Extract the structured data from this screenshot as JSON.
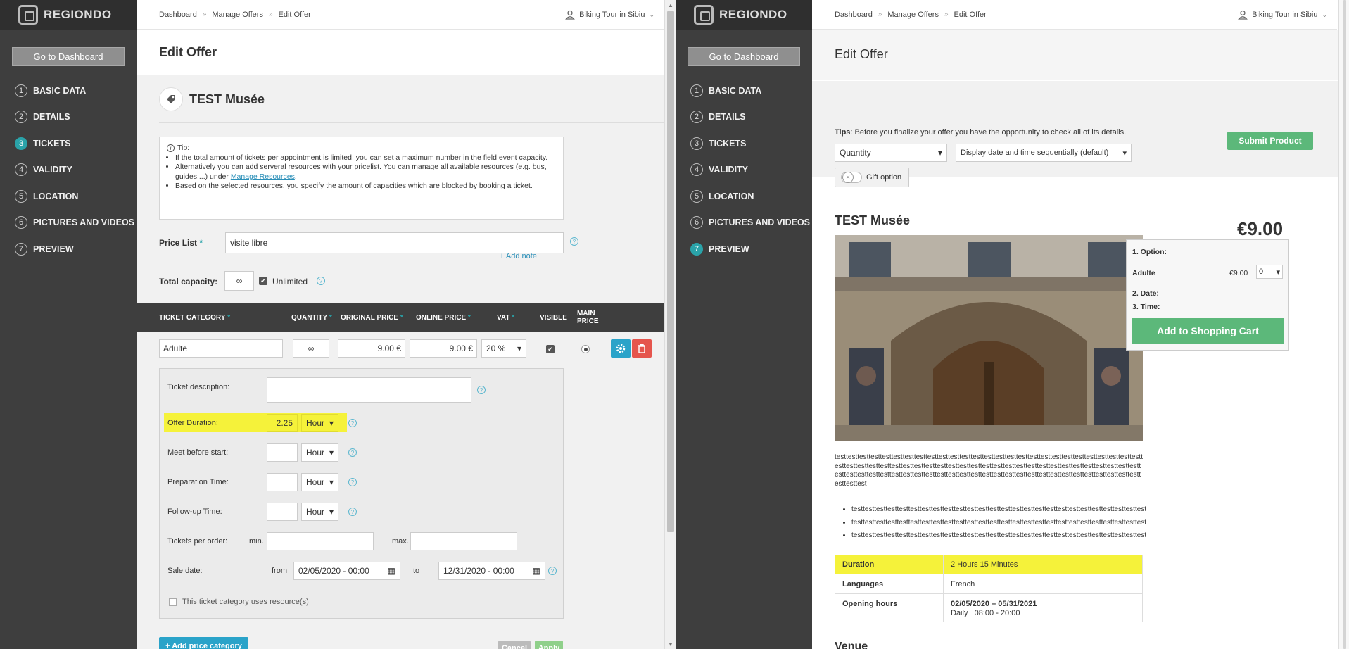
{
  "brand": "REGIONDO",
  "sidebar": {
    "dashboard_button": "Go to Dashboard",
    "items": [
      {
        "num": "1",
        "label": "BASIC DATA"
      },
      {
        "num": "2",
        "label": "DETAILS"
      },
      {
        "num": "3",
        "label": "TICKETS"
      },
      {
        "num": "4",
        "label": "VALIDITY"
      },
      {
        "num": "5",
        "label": "LOCATION"
      },
      {
        "num": "6",
        "label": "PICTURES AND VIDEOS"
      },
      {
        "num": "7",
        "label": "PREVIEW"
      }
    ]
  },
  "topbar": {
    "breadcrumbs": [
      "Dashboard",
      "Manage Offers",
      "Edit Offer"
    ],
    "separator": "»",
    "user": "Biking Tour in Sibiu"
  },
  "left": {
    "page_title": "Edit Offer",
    "offer_name": "TEST Musée",
    "tip": {
      "title": "Tip:",
      "items": [
        "If the total amount of tickets per appointment is limited, you can set a maximum number in the field event capacity.",
        "Alternatively you can add serveral resources with your pricelist. You can manage all available resources (e.g. bus, guides,...) under",
        "Based on the selected resources, you specify the amount of capacities which are blocked by booking a ticket."
      ],
      "link": "Manage Resources",
      "link_suffix": "."
    },
    "price_list_label": "Price List",
    "req_mark": "*",
    "price_list_value": "visite libre",
    "add_note": "+ Add note",
    "capacity_label": "Total capacity:",
    "capacity_value": "∞",
    "unlimited_label": "Unlimited",
    "table_headers": {
      "category": "TICKET CATEGORY",
      "quantity": "QUANTITY",
      "original_price": "ORIGINAL PRICE",
      "online_price": "ONLINE PRICE",
      "vat": "VAT",
      "visible": "VISIBLE",
      "main_price": "MAIN PRICE"
    },
    "row": {
      "category": "Adulte",
      "quantity": "∞",
      "original_price": "9.00",
      "online_price": "9.00",
      "currency": "€",
      "vat": "20 %"
    },
    "details": {
      "ticket_description_label": "Ticket description:",
      "offer_duration_label": "Offer Duration:",
      "offer_duration_value": "2.25",
      "unit": "Hour",
      "meet_before_label": "Meet before start:",
      "prep_label": "Preparation Time:",
      "followup_label": "Follow-up Time:",
      "tickets_per_order_label": "Tickets per order:",
      "min_label": "min.",
      "max_label": "max.",
      "sale_date_label": "Sale date:",
      "from_label": "from",
      "to_label": "to",
      "from_value": "02/05/2020 - 00:00",
      "to_value": "12/31/2020 - 00:00",
      "resource_checkbox": "This ticket category uses resource(s)"
    },
    "add_price_category": "+ Add price category",
    "cancel": "Cancel",
    "apply": "Apply"
  },
  "right": {
    "page_title": "Edit Offer",
    "tips_label": "Tips",
    "tips_text": ": Before you finalize your offer you have the opportunity to check all of its details.",
    "select_quantity": "Quantity",
    "select_display": "Display date and time sequentially (default)",
    "gift_option": "Gift option",
    "submit": "Submit Product",
    "offer_name": "TEST Musée",
    "price": "€9.00",
    "booking": {
      "option_label": "1. Option:",
      "ticket_name": "Adulte",
      "ticket_price": "€9.00",
      "qty": "0",
      "date_label": "2. Date:",
      "time_label": "3. Time:",
      "cart_button": "Add to Shopping Cart"
    },
    "description": "testtesttesttesttesttesttesttesttesttesttesttesttesttesttesttesttesttesttesttesttesttesttesttesttesttesttesttesttesttesttesttesttesttesttesttesttesttesttesttesttesttesttesttesttesttesttesttesttesttesttesttesttesttesttesttesttesttesttesttesttesttesttesttesttesttesttesttesttesttesttesttesttesttesttesttesttesttesttesttesttesttesttesttest",
    "bullets": [
      "testtesttesttesttesttesttesttesttesttesttesttesttesttesttesttesttesttesttesttesttesttesttesttesttesttest",
      "testtesttesttesttesttesttesttesttesttesttesttesttesttesttesttesttesttesttesttesttesttesttesttesttesttest",
      "testtesttesttesttesttesttesttesttesttesttesttesttesttesttesttesttesttesttesttesttesttesttesttesttesttest"
    ],
    "info": {
      "duration_label": "Duration",
      "duration_value": "2 Hours 15 Minutes",
      "languages_label": "Languages",
      "languages_value": "French",
      "opening_label": "Opening hours",
      "opening_range": "02/05/2020 – 05/31/2021",
      "opening_daily": "Daily   08:00 - 20:00"
    },
    "venue": "Venue"
  },
  "colors": {
    "sidebar_bg": "#3e3e3e",
    "accent": "#2aa3a9",
    "highlight": "#f5f23a",
    "green": "#5cb87a",
    "blue_button": "#2aa3c9",
    "red_button": "#e5554d"
  }
}
